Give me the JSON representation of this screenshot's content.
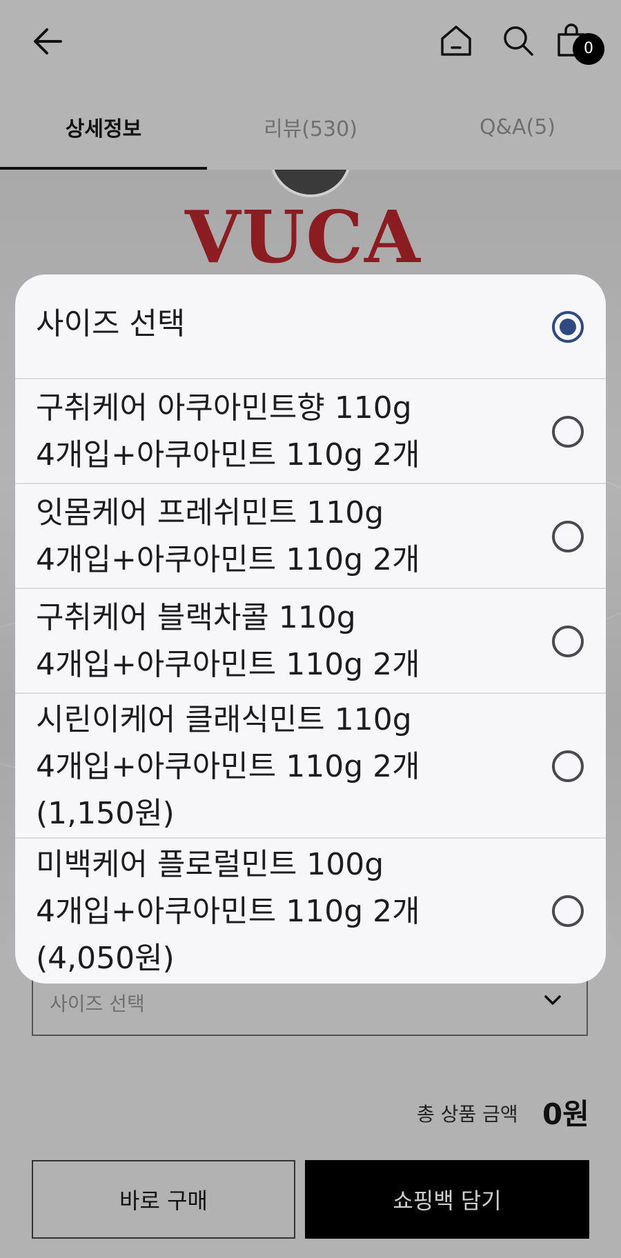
{
  "header": {
    "cart_count": "0"
  },
  "tabs": [
    {
      "label": "상세정보",
      "active": true
    },
    {
      "label": "리뷰(530)",
      "active": false
    },
    {
      "label": "Q&A(5)",
      "active": false
    }
  ],
  "product_image": {
    "brand_text": "VUCA"
  },
  "modal": {
    "options": [
      {
        "label": "사이즈 선택",
        "selected": true
      },
      {
        "label": "구취케어 아쿠아민트향 110g\n4개입+아쿠아민트 110g 2개",
        "selected": false
      },
      {
        "label": "잇몸케어 프레쉬민트 110g\n4개입+아쿠아민트 110g 2개",
        "selected": false
      },
      {
        "label": "구취케어 블랙차콜 110g\n4개입+아쿠아민트 110g 2개",
        "selected": false
      },
      {
        "label": "시린이케어 클래식민트 110g\n4개입+아쿠아민트 110g 2개\n(1,150원)",
        "selected": false
      },
      {
        "label": "미백케어 플로럴민트 100g\n4개입+아쿠아민트 110g 2개\n(4,050원)",
        "selected": false
      }
    ]
  },
  "purchase": {
    "size_select_placeholder": "사이즈 선택",
    "total_label": "총 상품 금액",
    "total_value": "0원",
    "buy_now_label": "바로 구매",
    "add_to_bag_label": "쇼핑백 담기"
  },
  "colors": {
    "radio_selected": "#2f4a7e",
    "overlay": "#b4b4b4",
    "primary_button": "#000000"
  },
  "icons": [
    "back-arrow-icon",
    "home-icon",
    "search-icon",
    "shopping-bag-icon",
    "chevron-down-icon",
    "radio-icon"
  ]
}
